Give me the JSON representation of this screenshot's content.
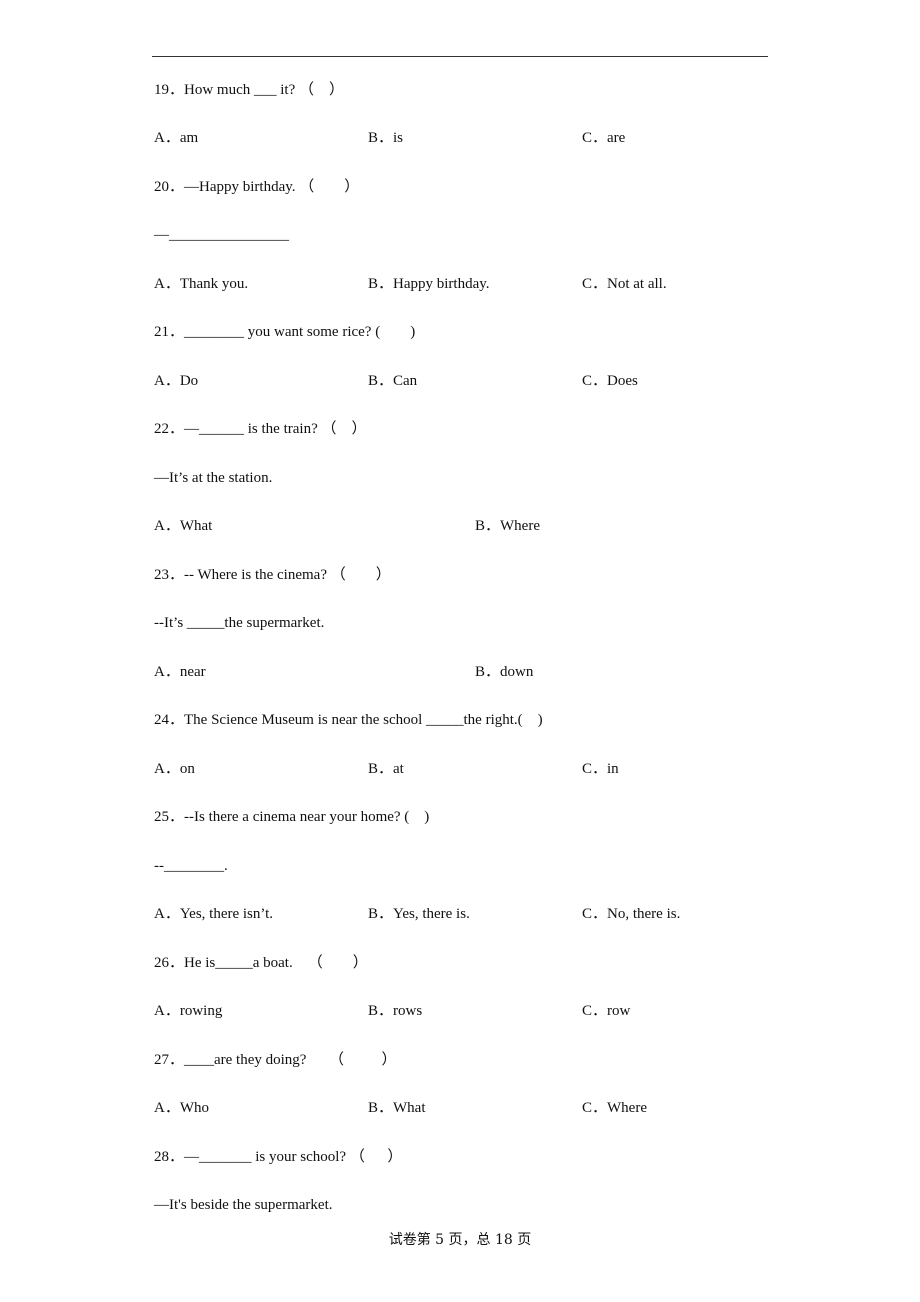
{
  "questions": [
    {
      "number": "19",
      "lines": [
        "19．How much ___ it? （    ）"
      ],
      "options": [
        "A．am",
        "B．is",
        "C．are"
      ]
    },
    {
      "number": "20",
      "lines": [
        "20．—Happy birthday. （        ）",
        "—________________"
      ],
      "options": [
        "A．Thank you.",
        "B．Happy birthday.",
        "C．Not at all."
      ]
    },
    {
      "number": "21",
      "lines": [
        "21．________ you want some rice? (        )"
      ],
      "options": [
        "A．Do",
        "B．Can",
        "C．Does"
      ]
    },
    {
      "number": "22",
      "lines": [
        "22．—______ is the train? （    ）",
        "—It’s at the station."
      ],
      "options": [
        "A．What",
        "B．Where"
      ]
    },
    {
      "number": "23",
      "lines": [
        "23．-- Where is the cinema? （        ）",
        "--It’s _____the supermarket."
      ],
      "options": [
        "A．near",
        "B．down"
      ]
    },
    {
      "number": "24",
      "lines": [
        "24．The Science Museum is near the school _____the right.(    )"
      ],
      "options": [
        "A．on",
        "B．at",
        "C．in"
      ]
    },
    {
      "number": "25",
      "lines": [
        "25．--Is there a cinema near your home? (    )",
        "--________."
      ],
      "options": [
        "A．Yes, there isn’t.",
        "B．Yes, there is.",
        "C．No, there is."
      ]
    },
    {
      "number": "26",
      "lines": [
        "26．He is_____a boat.    （        ）"
      ],
      "options": [
        "A．rowing",
        "B．rows",
        "C．row"
      ]
    },
    {
      "number": "27",
      "lines": [
        "27．____are they doing?      （          ）"
      ],
      "options": [
        "A．Who",
        "B．What",
        "C．Where"
      ]
    },
    {
      "number": "28",
      "lines": [
        "28．—_______ is your school? （      ）",
        "—It's beside the supermarket."
      ],
      "options": []
    }
  ],
  "footer": "试卷第 5 页，总 18 页"
}
